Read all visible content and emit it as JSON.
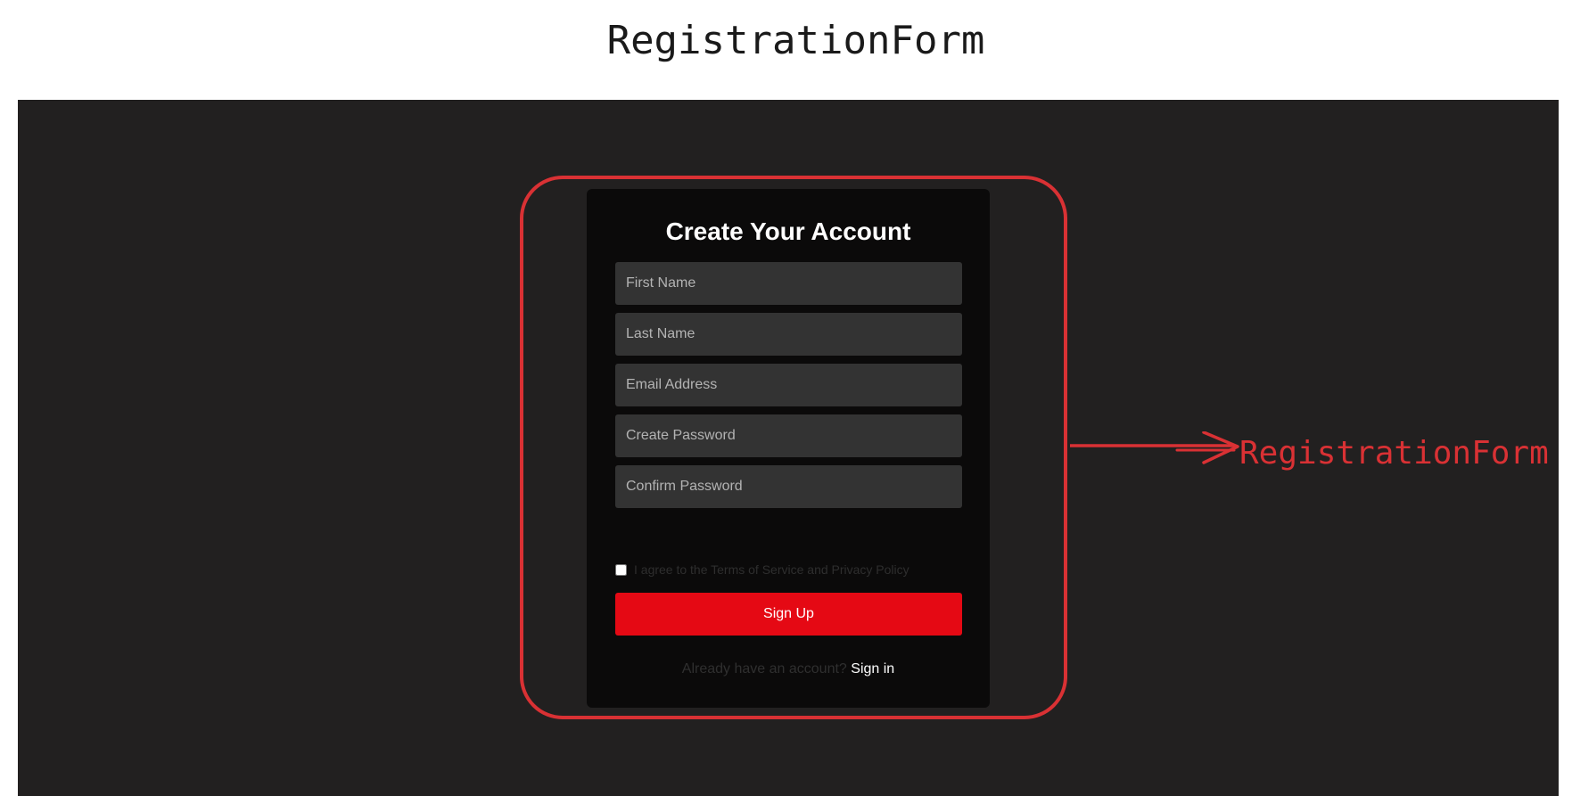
{
  "heading": "RegistrationForm",
  "annotation": {
    "label": "RegistrationForm",
    "color": "#d93134"
  },
  "form": {
    "title": "Create Your Account",
    "fields": [
      {
        "placeholder": "First Name",
        "value": ""
      },
      {
        "placeholder": "Last Name",
        "value": ""
      },
      {
        "placeholder": "Email Address",
        "value": ""
      },
      {
        "placeholder": "Create Password",
        "value": ""
      },
      {
        "placeholder": "Confirm Password",
        "value": ""
      }
    ],
    "terms_label": "I agree to the Terms of Service and Privacy Policy",
    "terms_checked": false,
    "submit_label": "Sign Up",
    "signin_prompt": "Already have an account? ",
    "signin_link": "Sign in"
  },
  "colors": {
    "canvas_bg": "#222020",
    "card_bg": "#0b0a0a",
    "input_bg": "#333333",
    "accent": "#e50914"
  }
}
